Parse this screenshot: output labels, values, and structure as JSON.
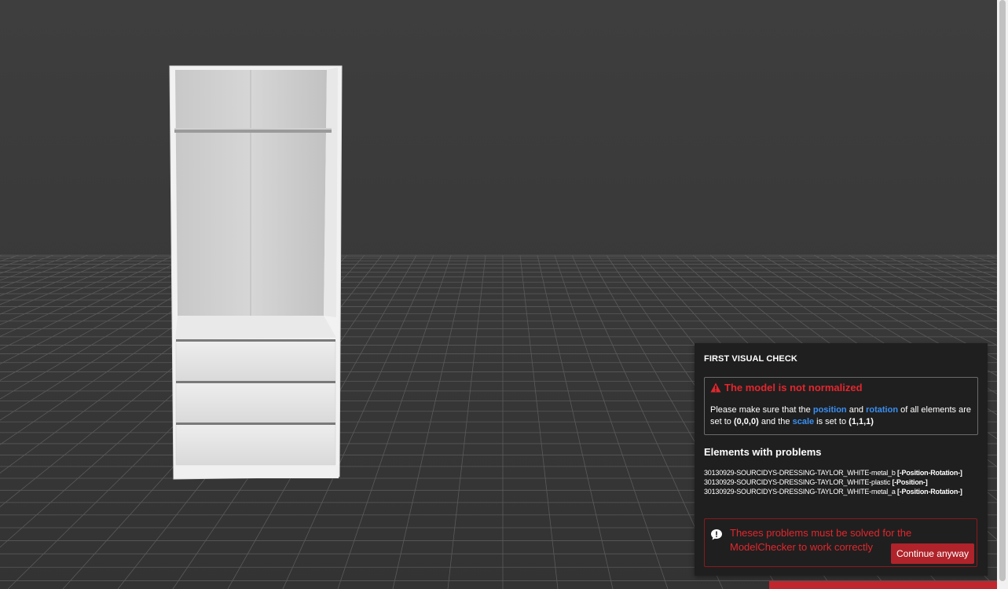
{
  "panel": {
    "title": "FIRST VISUAL CHECK",
    "warning": {
      "icon": "warning-triangle-icon",
      "title": "The model is not normalized",
      "text_before_position": "Please make sure that the ",
      "position": "position",
      "and": " and ",
      "rotation": "rotation",
      "text_after_rotation": " of all elements are set to ",
      "zero_value": "(0,0,0)",
      "and_the": " and the ",
      "scale": "scale",
      "is_set_to": " is set to ",
      "one_value": "(1,1,1)"
    },
    "elements_title": "Elements with problems",
    "elements": [
      {
        "name": "30130929-SOURCIDYS-DRESSING-TAYLOR_WHITE-metal_b ",
        "tag": "[-Position-Rotation-]"
      },
      {
        "name": "30130929-SOURCIDYS-DRESSING-TAYLOR_WHITE-plastic ",
        "tag": "[-Position-]"
      },
      {
        "name": "30130929-SOURCIDYS-DRESSING-TAYLOR_WHITE-metal_a ",
        "tag": "[-Position-Rotation-]"
      }
    ],
    "error": {
      "icon": "comment-info-icon",
      "text": "Theses problems must be solved for the ModelChecker to work correctly",
      "button": "Continue anyway"
    }
  },
  "colors": {
    "accent_red": "#e3262d",
    "link_blue": "#3a8ff2",
    "panel_bg": "#1f1f1f",
    "viewport_bg": "#3c3c3c"
  }
}
